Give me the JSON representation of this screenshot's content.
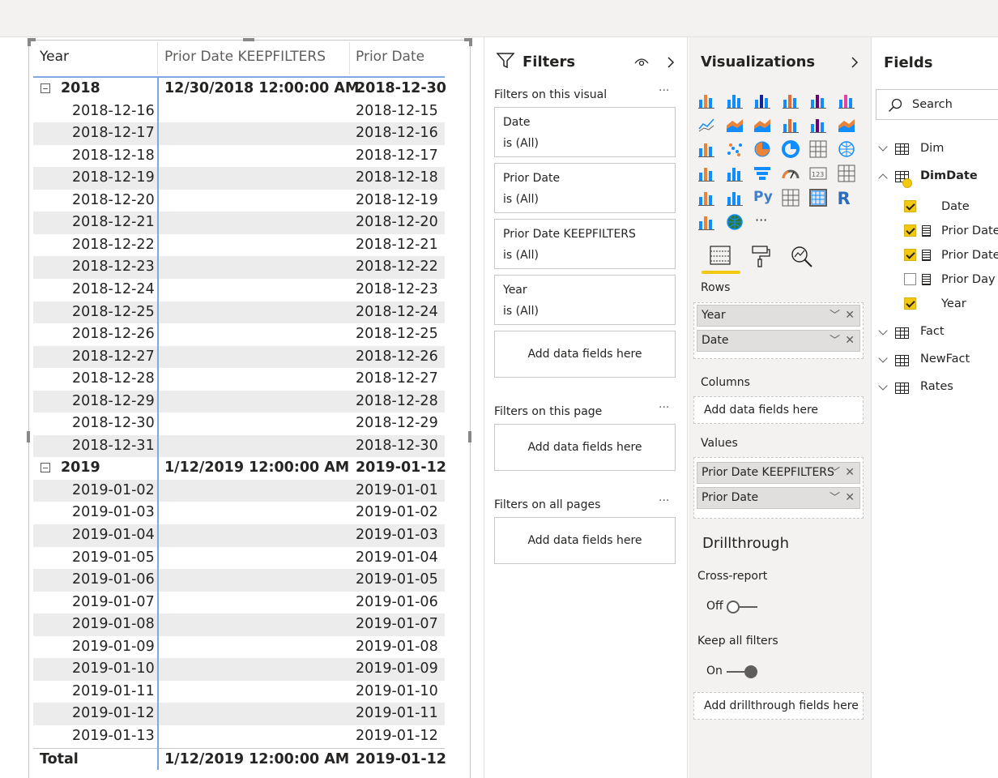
{
  "matrix": {
    "headers": {
      "year": "Year",
      "prior_keep": "Prior Date KEEPFILTERS",
      "prior": "Prior Date"
    },
    "rows": [
      {
        "type": "group",
        "year": "2018",
        "prior_keep": "12/30/2018 12:00:00 AM",
        "prior": "2018-12-30"
      },
      {
        "type": "detail",
        "year": "2018-12-16",
        "prior_keep": "",
        "prior": "2018-12-15"
      },
      {
        "type": "detail",
        "year": "2018-12-17",
        "prior_keep": "",
        "prior": "2018-12-16"
      },
      {
        "type": "detail",
        "year": "2018-12-18",
        "prior_keep": "",
        "prior": "2018-12-17"
      },
      {
        "type": "detail",
        "year": "2018-12-19",
        "prior_keep": "",
        "prior": "2018-12-18"
      },
      {
        "type": "detail",
        "year": "2018-12-20",
        "prior_keep": "",
        "prior": "2018-12-19"
      },
      {
        "type": "detail",
        "year": "2018-12-21",
        "prior_keep": "",
        "prior": "2018-12-20"
      },
      {
        "type": "detail",
        "year": "2018-12-22",
        "prior_keep": "",
        "prior": "2018-12-21"
      },
      {
        "type": "detail",
        "year": "2018-12-23",
        "prior_keep": "",
        "prior": "2018-12-22"
      },
      {
        "type": "detail",
        "year": "2018-12-24",
        "prior_keep": "",
        "prior": "2018-12-23"
      },
      {
        "type": "detail",
        "year": "2018-12-25",
        "prior_keep": "",
        "prior": "2018-12-24"
      },
      {
        "type": "detail",
        "year": "2018-12-26",
        "prior_keep": "",
        "prior": "2018-12-25"
      },
      {
        "type": "detail",
        "year": "2018-12-27",
        "prior_keep": "",
        "prior": "2018-12-26"
      },
      {
        "type": "detail",
        "year": "2018-12-28",
        "prior_keep": "",
        "prior": "2018-12-27"
      },
      {
        "type": "detail",
        "year": "2018-12-29",
        "prior_keep": "",
        "prior": "2018-12-28"
      },
      {
        "type": "detail",
        "year": "2018-12-30",
        "prior_keep": "",
        "prior": "2018-12-29"
      },
      {
        "type": "detail",
        "year": "2018-12-31",
        "prior_keep": "",
        "prior": "2018-12-30"
      },
      {
        "type": "group",
        "year": "2019",
        "prior_keep": "1/12/2019 12:00:00 AM",
        "prior": "2019-01-12"
      },
      {
        "type": "detail",
        "year": "2019-01-02",
        "prior_keep": "",
        "prior": "2019-01-01"
      },
      {
        "type": "detail",
        "year": "2019-01-03",
        "prior_keep": "",
        "prior": "2019-01-02"
      },
      {
        "type": "detail",
        "year": "2019-01-04",
        "prior_keep": "",
        "prior": "2019-01-03"
      },
      {
        "type": "detail",
        "year": "2019-01-05",
        "prior_keep": "",
        "prior": "2019-01-04"
      },
      {
        "type": "detail",
        "year": "2019-01-06",
        "prior_keep": "",
        "prior": "2019-01-05"
      },
      {
        "type": "detail",
        "year": "2019-01-07",
        "prior_keep": "",
        "prior": "2019-01-06"
      },
      {
        "type": "detail",
        "year": "2019-01-08",
        "prior_keep": "",
        "prior": "2019-01-07"
      },
      {
        "type": "detail",
        "year": "2019-01-09",
        "prior_keep": "",
        "prior": "2019-01-08"
      },
      {
        "type": "detail",
        "year": "2019-01-10",
        "prior_keep": "",
        "prior": "2019-01-09"
      },
      {
        "type": "detail",
        "year": "2019-01-11",
        "prior_keep": "",
        "prior": "2019-01-10"
      },
      {
        "type": "detail",
        "year": "2019-01-12",
        "prior_keep": "",
        "prior": "2019-01-11"
      },
      {
        "type": "detail",
        "year": "2019-01-13",
        "prior_keep": "",
        "prior": "2019-01-12"
      }
    ],
    "total": {
      "label": "Total",
      "prior_keep": "1/12/2019 12:00:00 AM",
      "prior": "2019-01-12"
    }
  },
  "filters": {
    "title": "Filters",
    "visual_section": "Filters on this visual",
    "cards": [
      {
        "name": "Date",
        "value": "is (All)"
      },
      {
        "name": "Prior Date",
        "value": "is (All)"
      },
      {
        "name": "Prior Date KEEPFILTERS",
        "value": "is (All)"
      },
      {
        "name": "Year",
        "value": "is (All)"
      }
    ],
    "add_label": "Add data fields here",
    "page_section": "Filters on this page",
    "all_section": "Filters on all pages",
    "more": "···"
  },
  "visualizations": {
    "title": "Visualizations",
    "rows_label": "Rows",
    "rows": [
      "Year",
      "Date"
    ],
    "columns_label": "Columns",
    "columns_add": "Add data fields here",
    "values_label": "Values",
    "values": [
      "Prior Date KEEPFILTERS",
      "Prior Date"
    ],
    "drillthrough_title": "Drillthrough",
    "cross_report_label": "Cross-report",
    "cross_report_state": "Off",
    "keep_filters_label": "Keep all filters",
    "keep_filters_state": "On",
    "drill_add": "Add drillthrough fields here",
    "more": "···",
    "accent": "#f2c811"
  },
  "fields": {
    "title": "Fields",
    "search_placeholder": "Search",
    "tables": [
      {
        "name": "Dim"
      },
      {
        "name": "DimDate"
      },
      {
        "name": "Fact"
      },
      {
        "name": "NewFact"
      },
      {
        "name": "Rates"
      }
    ],
    "dimdate_fields": [
      {
        "name": "Date",
        "checked": true
      },
      {
        "name": "Prior Date",
        "checked": true
      },
      {
        "name": "Prior Date",
        "checked": true
      },
      {
        "name": "Prior Day A",
        "checked": false
      },
      {
        "name": "Year",
        "checked": true
      }
    ]
  }
}
